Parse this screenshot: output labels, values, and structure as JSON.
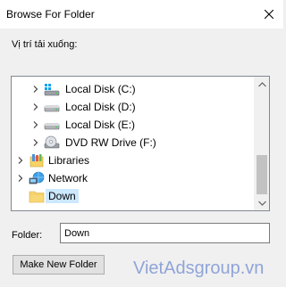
{
  "dialog": {
    "title": "Browse For Folder",
    "instruction": "Vị trí tải xuống:"
  },
  "tree": {
    "items": [
      {
        "label": "Local Disk (C:)",
        "icon": "windows-drive-icon",
        "expander": "collapsed"
      },
      {
        "label": "Local Disk (D:)",
        "icon": "hard-drive-icon",
        "expander": "collapsed"
      },
      {
        "label": "Local Disk (E:)",
        "icon": "hard-drive-icon",
        "expander": "collapsed"
      },
      {
        "label": "DVD RW Drive (F:)",
        "icon": "dvd-drive-icon",
        "expander": "collapsed"
      },
      {
        "label": "Libraries",
        "icon": "libraries-icon",
        "expander": "collapsed"
      },
      {
        "label": "Network",
        "icon": "network-icon",
        "expander": "collapsed"
      },
      {
        "label": "Down",
        "icon": "folder-icon",
        "expander": "none",
        "selected": true
      }
    ],
    "selection_color": "#cce8ff"
  },
  "folder": {
    "label": "Folder:",
    "value": "Down"
  },
  "buttons": {
    "make_new_folder": "Make New Folder"
  },
  "watermark": "VietAdsgroup.vn"
}
